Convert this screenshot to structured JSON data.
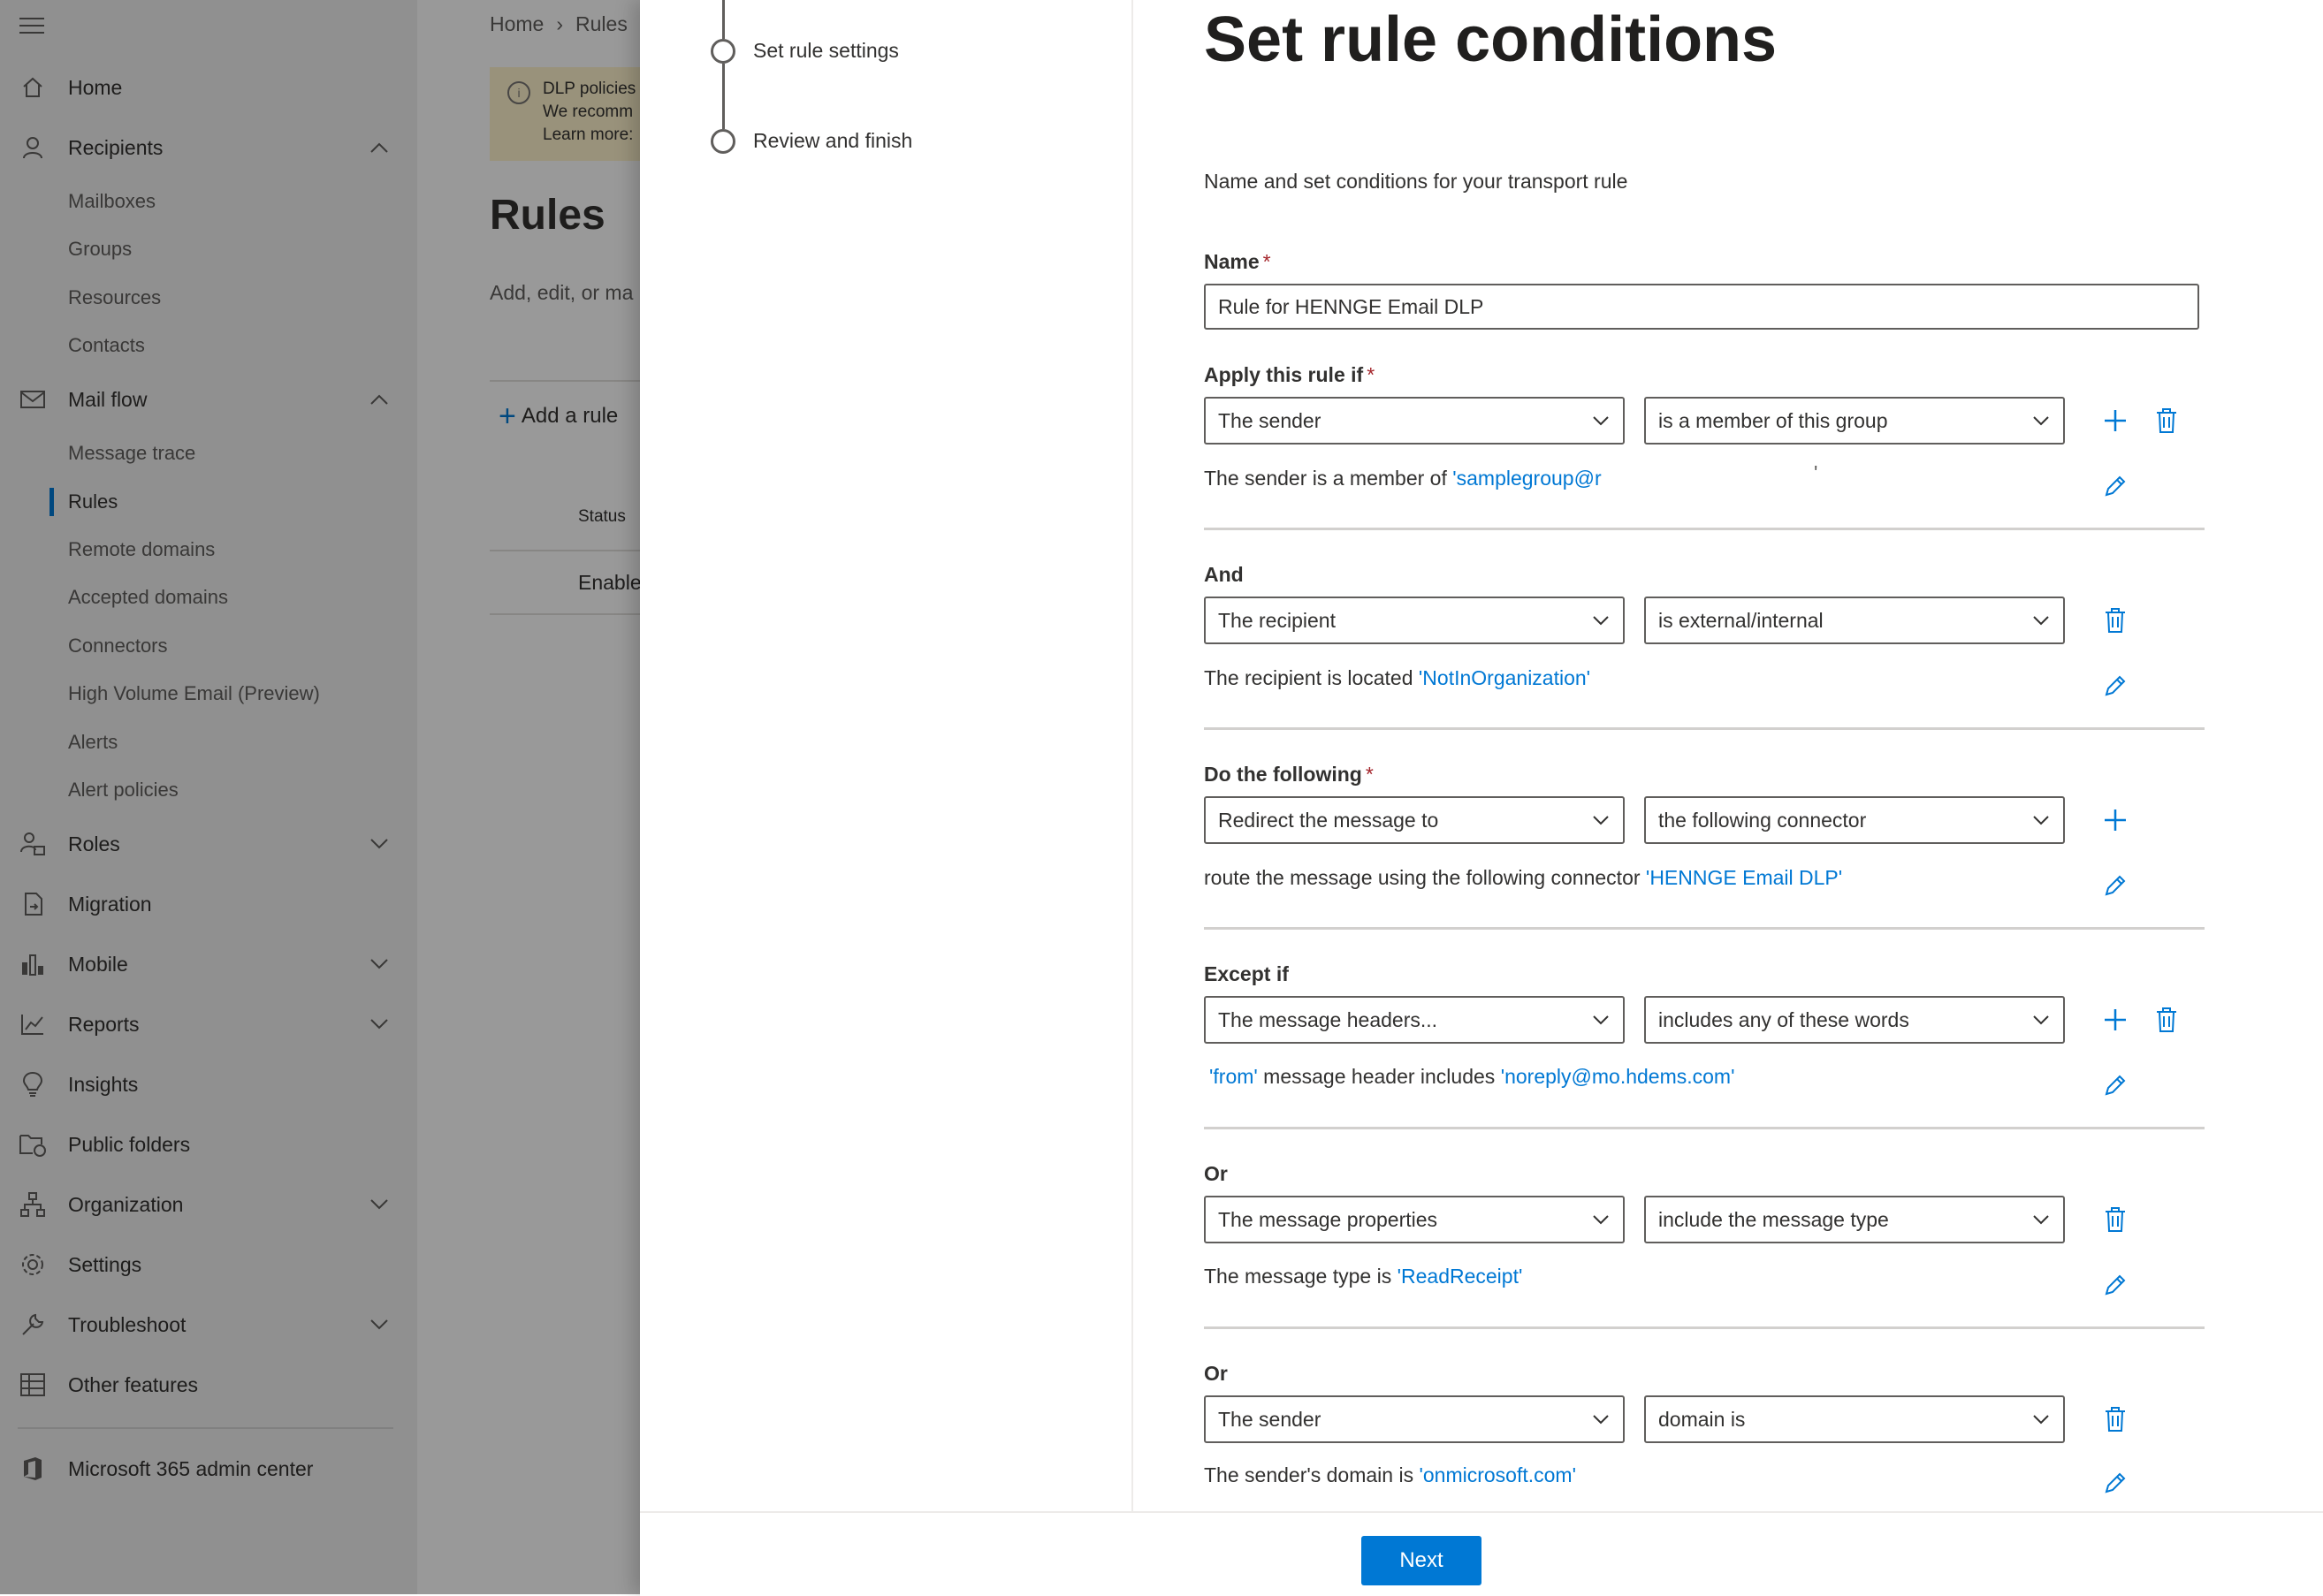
{
  "nav": {
    "items": [
      {
        "key": "home",
        "label": "Home",
        "icon": "home-icon"
      },
      {
        "key": "recipients",
        "label": "Recipients",
        "icon": "person-icon",
        "expanded": true,
        "children": [
          "Mailboxes",
          "Groups",
          "Resources",
          "Contacts"
        ]
      },
      {
        "key": "mailflow",
        "label": "Mail flow",
        "icon": "mail-icon",
        "expanded": true,
        "children": [
          "Message trace",
          "Rules",
          "Remote domains",
          "Accepted domains",
          "Connectors",
          "High Volume Email (Preview)",
          "Alerts",
          "Alert policies"
        ]
      },
      {
        "key": "roles",
        "label": "Roles",
        "icon": "roles-icon"
      },
      {
        "key": "migration",
        "label": "Migration",
        "icon": "migration-icon"
      },
      {
        "key": "mobile",
        "label": "Mobile",
        "icon": "mobile-icon"
      },
      {
        "key": "reports",
        "label": "Reports",
        "icon": "reports-icon"
      },
      {
        "key": "insights",
        "label": "Insights",
        "icon": "lightbulb-icon"
      },
      {
        "key": "publicfolders",
        "label": "Public folders",
        "icon": "folder-icon"
      },
      {
        "key": "organization",
        "label": "Organization",
        "icon": "org-icon"
      },
      {
        "key": "settings",
        "label": "Settings",
        "icon": "gear-icon"
      },
      {
        "key": "troubleshoot",
        "label": "Troubleshoot",
        "icon": "wrench-icon"
      },
      {
        "key": "otherfeatures",
        "label": "Other features",
        "icon": "table-icon"
      }
    ],
    "active_sub": "Rules",
    "admin_center": "Microsoft 365 admin center"
  },
  "background_page": {
    "breadcrumb": [
      "Home",
      "Rules"
    ],
    "warning_lines": [
      "DLP policies",
      "We recomm",
      "Learn more:"
    ],
    "title": "Rules",
    "subtitle": "Add, edit, or ma",
    "add_rule": "Add a rule",
    "status_header": "Status",
    "status_value": "Enable"
  },
  "wizard": {
    "steps": [
      "Set rule settings",
      "Review and finish"
    ],
    "title": "Set rule conditions",
    "subtitle": "Name and set conditions for your transport rule",
    "name_label": "Name",
    "name_value": "Rule for HENNGE Email DLP",
    "sections": [
      {
        "label": "Apply this rule if",
        "required": true,
        "dd1": "The sender",
        "dd2": "is a member of this group",
        "summary_text": "The sender is a member of ",
        "summary_link": "'samplegroup@r",
        "trailing": "'",
        "actions": [
          "add",
          "delete"
        ]
      },
      {
        "label": "And",
        "required": false,
        "dd1": "The recipient",
        "dd2": "is external/internal",
        "summary_text": "The recipient is located ",
        "summary_link": "'NotInOrganization'",
        "actions": [
          "delete"
        ]
      },
      {
        "label": "Do the following",
        "required": true,
        "dd1": "Redirect the message to",
        "dd2": "the following connector",
        "summary_text": "route the message using the following connector ",
        "summary_link": "'HENNGE Email DLP'",
        "actions": [
          "add"
        ]
      },
      {
        "label": "Except if",
        "required": false,
        "dd1": "The message headers...",
        "dd2": "includes any of these words",
        "summary_pre_link": "'from'",
        "summary_text": " message header includes ",
        "summary_link": "'noreply@mo.hdems.com'",
        "actions": [
          "add",
          "delete"
        ]
      },
      {
        "label": "Or",
        "required": false,
        "dd1": "The message properties",
        "dd2": "include the message type",
        "summary_text": "The message type is ",
        "summary_link": "'ReadReceipt'",
        "actions": [
          "delete"
        ]
      },
      {
        "label": "Or",
        "required": false,
        "dd1": "The sender",
        "dd2": "domain is",
        "summary_text": "The sender's domain is ",
        "summary_link": "'onmicrosoft.com'",
        "actions": [
          "delete"
        ]
      }
    ],
    "next_label": "Next"
  },
  "colors": {
    "accent": "#0078d4",
    "required": "#a4262c",
    "nav_bg": "#f0f0f0",
    "warning_bg": "#fff4ce"
  }
}
